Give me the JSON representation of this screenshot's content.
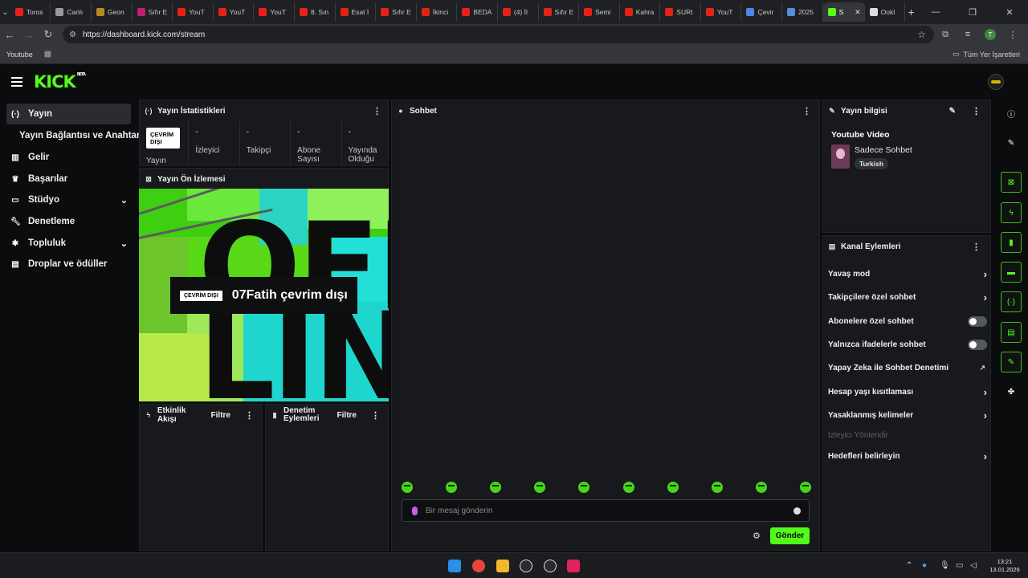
{
  "browser": {
    "tabs": [
      {
        "label": "Toros",
        "color": "#e62117"
      },
      {
        "label": "Canlı",
        "color": "#9a9a9a"
      },
      {
        "label": "Geon",
        "color": "#b58b2a"
      },
      {
        "label": "Sıfır E",
        "color": "#c0206b"
      },
      {
        "label": "YouT",
        "color": "#e62117"
      },
      {
        "label": "YouT",
        "color": "#e62117"
      },
      {
        "label": "YouT",
        "color": "#e62117"
      },
      {
        "label": "8. Sın",
        "color": "#e62117"
      },
      {
        "label": "Esat İ",
        "color": "#e62117"
      },
      {
        "label": "Sıfır E",
        "color": "#e62117"
      },
      {
        "label": "İkinci",
        "color": "#e62117"
      },
      {
        "label": "BEDA",
        "color": "#e62117"
      },
      {
        "label": "(4) İl",
        "color": "#e62117"
      },
      {
        "label": "Sıfır E",
        "color": "#e62117"
      },
      {
        "label": "Semi",
        "color": "#e62117"
      },
      {
        "label": "Kahra",
        "color": "#e62117"
      },
      {
        "label": "SURI",
        "color": "#e62117"
      },
      {
        "label": "YouT",
        "color": "#e62117"
      },
      {
        "label": "Çevir",
        "color": "#4a86e8"
      },
      {
        "label": "2025",
        "color": "#5a8bd8"
      },
      {
        "label": "S",
        "color": "#53fc18",
        "active": true
      },
      {
        "label": "Ookl",
        "color": "#dddddd"
      }
    ],
    "url": "https://dashboard.kick.com/stream",
    "profile_initial": "T",
    "bookmark_youtube": "Youtube",
    "bookmark_all": "Tüm Yer İşaretleri"
  },
  "kick": {
    "logo": "KICK",
    "beta": "BETA"
  },
  "sidebar": {
    "items": [
      {
        "label": "Yayın",
        "icon": "broadcast-icon"
      },
      {
        "label": "Yayın Bağlantısı ve Anahtarı"
      },
      {
        "label": "Gelir",
        "icon": "chart-icon"
      },
      {
        "label": "Başarılar",
        "icon": "trophy-icon"
      },
      {
        "label": "Stüdyo",
        "icon": "studio-icon"
      },
      {
        "label": "Denetleme",
        "icon": "wrench-icon"
      },
      {
        "label": "Topluluk",
        "icon": "community-icon"
      },
      {
        "label": "Droplar ve ödüller",
        "icon": "gift-icon"
      }
    ]
  },
  "stats": {
    "title": "Yayın İstatistikleri",
    "status_badge": "ÇEVRİM DIŞI",
    "status_label": "Yayın",
    "columns": [
      {
        "value": "-",
        "label": "İzleyici"
      },
      {
        "value": "-",
        "label": "Takipçi"
      },
      {
        "value": "-",
        "label": "Abone Sayısı"
      },
      {
        "value": "-",
        "label": "Yayında Olduğu"
      }
    ]
  },
  "preview": {
    "title": "Yayın Ön İzlemesi",
    "badge": "ÇEVRİM DIŞI",
    "offline_text": "07Fatih çevrim dışı",
    "letters_top": "OFF",
    "letters_bottom": "LIN"
  },
  "activity": {
    "title": "Etkinlik Akışı",
    "filter": "Filtre"
  },
  "moderation": {
    "title": "Denetim Eylemleri",
    "filter": "Filtre"
  },
  "chat": {
    "title": "Sohbet",
    "placeholder": "Bir mesaj gönderin",
    "send": "Gönder"
  },
  "stream_info": {
    "title": "Yayın bilgisi",
    "stream_title": "Youtube Video",
    "category": "Sadece Sohbet",
    "tag": "Turkish"
  },
  "channel_actions": {
    "title": "Kanal Eylemleri",
    "items": [
      {
        "label": "Yavaş mod",
        "kind": "chevron"
      },
      {
        "label": "Takipçilere özel sohbet",
        "kind": "chevron"
      },
      {
        "label": "Abonelere özel sohbet",
        "kind": "toggle"
      },
      {
        "label": "Yalnızca ifadelerle sohbet",
        "kind": "toggle"
      },
      {
        "label": "Yapay Zeka ile Sohbet Denetimi",
        "kind": "external"
      },
      {
        "label": "Hesap yaşı kısıtlaması",
        "kind": "chevron"
      },
      {
        "label": "Yasaklanmış kelimeler",
        "kind": "chevron"
      },
      {
        "label": "İzleyici Yönlendir",
        "kind": "disabled"
      },
      {
        "label": "Hedefleri belirleyin",
        "kind": "chevron"
      }
    ]
  },
  "taskbar": {
    "time": "13:21",
    "date": "13.01.2026"
  }
}
